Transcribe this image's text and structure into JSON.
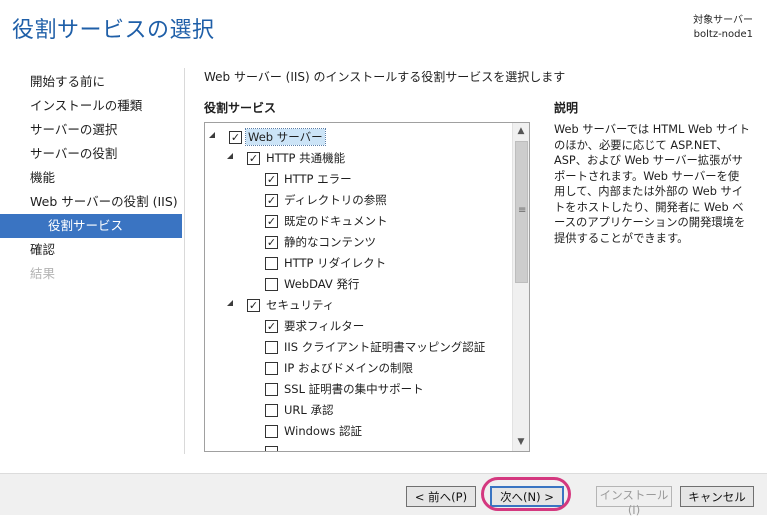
{
  "title": "役割サービスの選択",
  "target": {
    "label": "対象サーバー",
    "server": "boltz-node1"
  },
  "nav": [
    {
      "label": "開始する前に",
      "state": "normal"
    },
    {
      "label": "インストールの種類",
      "state": "normal"
    },
    {
      "label": "サーバーの選択",
      "state": "normal"
    },
    {
      "label": "サーバーの役割",
      "state": "normal"
    },
    {
      "label": "機能",
      "state": "normal"
    },
    {
      "label": "Web サーバーの役割 (IIS)",
      "state": "normal"
    },
    {
      "label": "役割サービス",
      "state": "active"
    },
    {
      "label": "確認",
      "state": "normal"
    },
    {
      "label": "結果",
      "state": "disabled"
    }
  ],
  "intro": "Web サーバー (IIS) のインストールする役割サービスを選択します",
  "role_services_label": "役割サービス",
  "description_label": "説明",
  "description": "Web サーバーでは HTML Web サイトのほか、必要に応じて ASP.NET、ASP、および Web サーバー拡張がサポートされます。Web サーバーを使用して、内部または外部の Web サイトをホストしたり、開発者に Web ベースのアプリケーションの開発環境を提供することができます。",
  "tree": [
    {
      "label": "Web サーバー",
      "level": 0,
      "expandable": true,
      "checked": true,
      "selected": true
    },
    {
      "label": "HTTP 共通機能",
      "level": 1,
      "expandable": true,
      "checked": true
    },
    {
      "label": "HTTP エラー",
      "level": 2,
      "checked": true
    },
    {
      "label": "ディレクトリの参照",
      "level": 2,
      "checked": true
    },
    {
      "label": "既定のドキュメント",
      "level": 2,
      "checked": true
    },
    {
      "label": "静的なコンテンツ",
      "level": 2,
      "checked": true
    },
    {
      "label": "HTTP リダイレクト",
      "level": 2,
      "checked": false
    },
    {
      "label": "WebDAV 発行",
      "level": 2,
      "checked": false
    },
    {
      "label": "セキュリティ",
      "level": 1,
      "expandable": true,
      "checked": true
    },
    {
      "label": "要求フィルター",
      "level": 2,
      "checked": true
    },
    {
      "label": "IIS クライアント証明書マッピング認証",
      "level": 2,
      "checked": false
    },
    {
      "label": "IP およびドメインの制限",
      "level": 2,
      "checked": false
    },
    {
      "label": "SSL 証明書の集中サポート",
      "level": 2,
      "checked": false
    },
    {
      "label": "URL 承認",
      "level": 2,
      "checked": false
    },
    {
      "label": "Windows 認証",
      "level": 2,
      "checked": false
    },
    {
      "label": "",
      "level": 2,
      "checked": false
    }
  ],
  "buttons": {
    "prev": "< 前へ(P)",
    "next": "次へ(N) >",
    "install": "インストール(I)",
    "cancel": "キャンセル"
  },
  "icons": {
    "checked": "check-mark",
    "expander": "triangle-expanded",
    "scroll_up": "chevron-up",
    "scroll_down": "chevron-down"
  },
  "colors": {
    "title": "#1f5fa8",
    "nav_active": "#3a74c2",
    "highlight": "#d4387f"
  }
}
